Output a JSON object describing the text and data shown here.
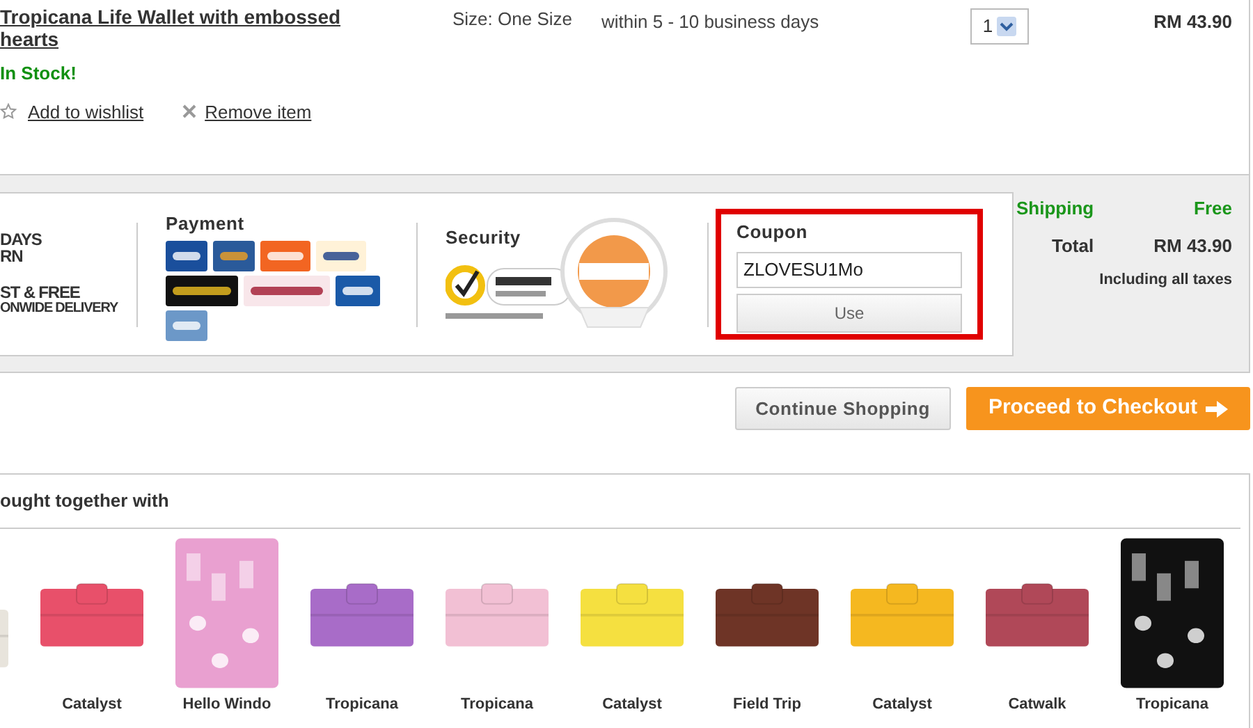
{
  "cart_item": {
    "title": "Tropicana Life Wallet with embossed hearts",
    "stock": "In Stock!",
    "size": "Size: One Size",
    "delivery": "within 5 - 10 business days",
    "quantity": "1",
    "price": "RM 43.90",
    "actions": [
      "Add to wishlist",
      "Remove item"
    ]
  },
  "promo_banner": [
    "DAYS",
    "RN",
    "ST & FREE",
    "ONWIDE DELIVERY"
  ],
  "payment": {
    "title": "Payment"
  },
  "security": {
    "title": "Security"
  },
  "coupon": {
    "title": "Coupon",
    "value": "ZLOVESU1Mo",
    "button": "Use",
    "highlighted": true
  },
  "summary": {
    "shipping_label": "Shipping",
    "shipping_value": "Free",
    "total_label": "Total",
    "total_value": "RM 43.90",
    "note": "Including all taxes"
  },
  "buttons": {
    "continue": "Continue Shopping",
    "checkout": "Proceed to Checkout"
  },
  "recommendations": {
    "title": "ought together with",
    "items": [
      {
        "color": "#e8e4dc"
      },
      {
        "color": "#e8506a",
        "name": "Catalyst"
      },
      {
        "color": "#e9a0d0",
        "name": "Hello Windo"
      },
      {
        "color": "#a86cc8",
        "name": "Tropicana"
      },
      {
        "color": "#f2c0d4",
        "name": "Tropicana"
      },
      {
        "color": "#f5e040",
        "name": "Catalyst"
      },
      {
        "color": "#6e3426",
        "name": "Field Trip"
      },
      {
        "color": "#f5b820",
        "name": "Catalyst"
      },
      {
        "color": "#b04858",
        "name": "Catwalk"
      },
      {
        "color": "#111111",
        "name": "Tropicana"
      }
    ]
  }
}
